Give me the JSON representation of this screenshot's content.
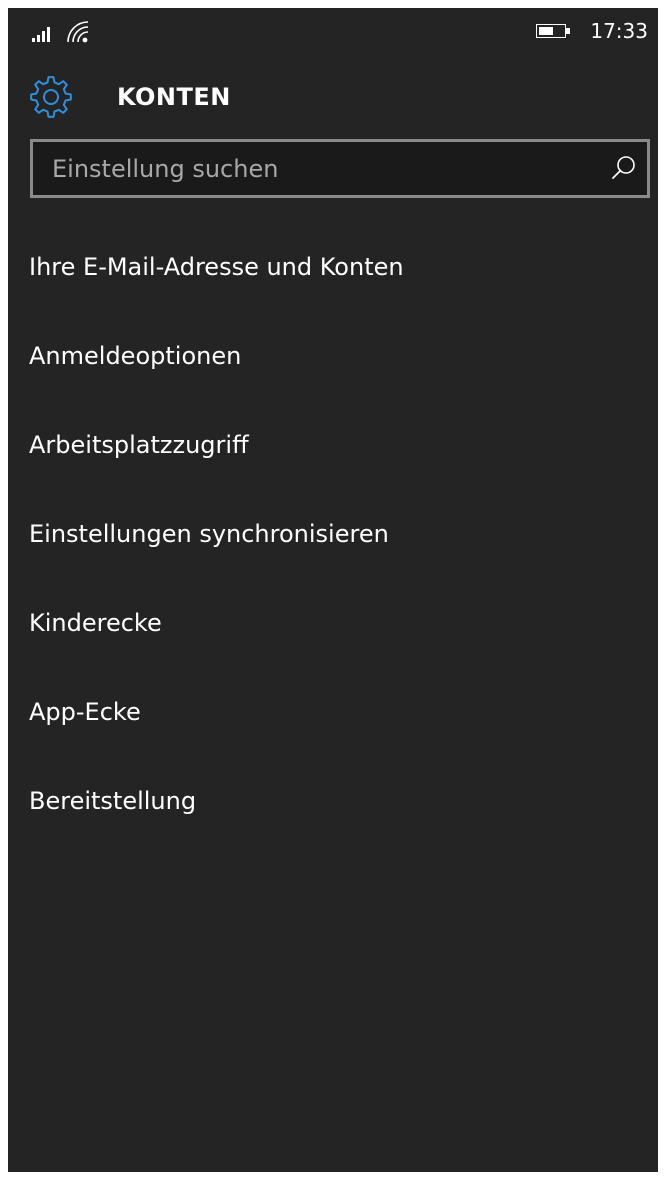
{
  "status_bar": {
    "signal_icon": "signal-strength-icon",
    "wifi_icon": "wifi-icon",
    "battery_icon": "battery-icon",
    "battery_level": 0.6,
    "time": "17:33"
  },
  "header": {
    "icon": "gear-icon",
    "accent_color": "#2e8fe0",
    "title": "KONTEN"
  },
  "search": {
    "placeholder": "Einstellung suchen",
    "value": "",
    "icon": "search-icon"
  },
  "menu": {
    "items": [
      {
        "label": "Ihre E-Mail-Adresse und Konten"
      },
      {
        "label": "Anmeldeoptionen"
      },
      {
        "label": "Arbeitsplatzzugriff"
      },
      {
        "label": "Einstellungen synchronisieren"
      },
      {
        "label": "Kinderecke"
      },
      {
        "label": "App-Ecke"
      },
      {
        "label": "Bereitstellung"
      }
    ]
  },
  "colors": {
    "background": "#242424",
    "text": "#ffffff",
    "search_border": "#8a8a8a",
    "search_background": "#1a1a1a",
    "placeholder": "#a8a8a8"
  }
}
